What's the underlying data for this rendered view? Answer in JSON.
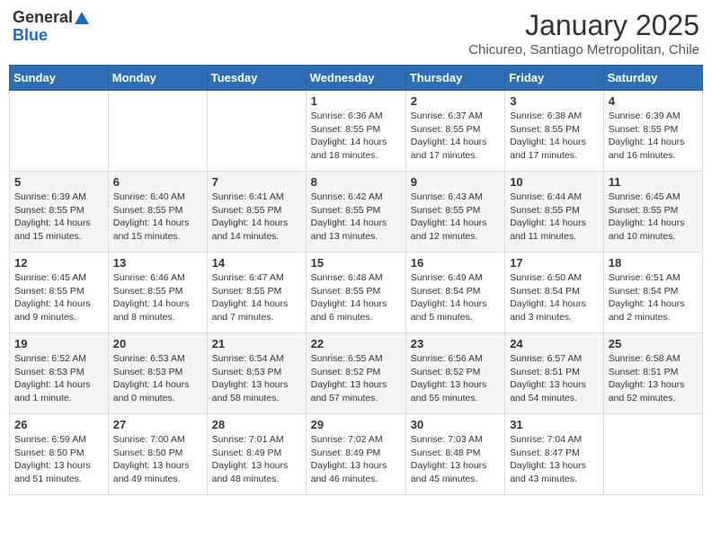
{
  "header": {
    "logo_general": "General",
    "logo_blue": "Blue",
    "month_title": "January 2025",
    "location": "Chicureo, Santiago Metropolitan, Chile"
  },
  "weekdays": [
    "Sunday",
    "Monday",
    "Tuesday",
    "Wednesday",
    "Thursday",
    "Friday",
    "Saturday"
  ],
  "weeks": [
    [
      {
        "day": "",
        "sunrise": "",
        "sunset": "",
        "daylight": ""
      },
      {
        "day": "",
        "sunrise": "",
        "sunset": "",
        "daylight": ""
      },
      {
        "day": "",
        "sunrise": "",
        "sunset": "",
        "daylight": ""
      },
      {
        "day": "1",
        "sunrise": "Sunrise: 6:36 AM",
        "sunset": "Sunset: 8:55 PM",
        "daylight": "Daylight: 14 hours and 18 minutes."
      },
      {
        "day": "2",
        "sunrise": "Sunrise: 6:37 AM",
        "sunset": "Sunset: 8:55 PM",
        "daylight": "Daylight: 14 hours and 17 minutes."
      },
      {
        "day": "3",
        "sunrise": "Sunrise: 6:38 AM",
        "sunset": "Sunset: 8:55 PM",
        "daylight": "Daylight: 14 hours and 17 minutes."
      },
      {
        "day": "4",
        "sunrise": "Sunrise: 6:39 AM",
        "sunset": "Sunset: 8:55 PM",
        "daylight": "Daylight: 14 hours and 16 minutes."
      }
    ],
    [
      {
        "day": "5",
        "sunrise": "Sunrise: 6:39 AM",
        "sunset": "Sunset: 8:55 PM",
        "daylight": "Daylight: 14 hours and 15 minutes."
      },
      {
        "day": "6",
        "sunrise": "Sunrise: 6:40 AM",
        "sunset": "Sunset: 8:55 PM",
        "daylight": "Daylight: 14 hours and 15 minutes."
      },
      {
        "day": "7",
        "sunrise": "Sunrise: 6:41 AM",
        "sunset": "Sunset: 8:55 PM",
        "daylight": "Daylight: 14 hours and 14 minutes."
      },
      {
        "day": "8",
        "sunrise": "Sunrise: 6:42 AM",
        "sunset": "Sunset: 8:55 PM",
        "daylight": "Daylight: 14 hours and 13 minutes."
      },
      {
        "day": "9",
        "sunrise": "Sunrise: 6:43 AM",
        "sunset": "Sunset: 8:55 PM",
        "daylight": "Daylight: 14 hours and 12 minutes."
      },
      {
        "day": "10",
        "sunrise": "Sunrise: 6:44 AM",
        "sunset": "Sunset: 8:55 PM",
        "daylight": "Daylight: 14 hours and 11 minutes."
      },
      {
        "day": "11",
        "sunrise": "Sunrise: 6:45 AM",
        "sunset": "Sunset: 8:55 PM",
        "daylight": "Daylight: 14 hours and 10 minutes."
      }
    ],
    [
      {
        "day": "12",
        "sunrise": "Sunrise: 6:45 AM",
        "sunset": "Sunset: 8:55 PM",
        "daylight": "Daylight: 14 hours and 9 minutes."
      },
      {
        "day": "13",
        "sunrise": "Sunrise: 6:46 AM",
        "sunset": "Sunset: 8:55 PM",
        "daylight": "Daylight: 14 hours and 8 minutes."
      },
      {
        "day": "14",
        "sunrise": "Sunrise: 6:47 AM",
        "sunset": "Sunset: 8:55 PM",
        "daylight": "Daylight: 14 hours and 7 minutes."
      },
      {
        "day": "15",
        "sunrise": "Sunrise: 6:48 AM",
        "sunset": "Sunset: 8:55 PM",
        "daylight": "Daylight: 14 hours and 6 minutes."
      },
      {
        "day": "16",
        "sunrise": "Sunrise: 6:49 AM",
        "sunset": "Sunset: 8:54 PM",
        "daylight": "Daylight: 14 hours and 5 minutes."
      },
      {
        "day": "17",
        "sunrise": "Sunrise: 6:50 AM",
        "sunset": "Sunset: 8:54 PM",
        "daylight": "Daylight: 14 hours and 3 minutes."
      },
      {
        "day": "18",
        "sunrise": "Sunrise: 6:51 AM",
        "sunset": "Sunset: 8:54 PM",
        "daylight": "Daylight: 14 hours and 2 minutes."
      }
    ],
    [
      {
        "day": "19",
        "sunrise": "Sunrise: 6:52 AM",
        "sunset": "Sunset: 8:53 PM",
        "daylight": "Daylight: 14 hours and 1 minute."
      },
      {
        "day": "20",
        "sunrise": "Sunrise: 6:53 AM",
        "sunset": "Sunset: 8:53 PM",
        "daylight": "Daylight: 14 hours and 0 minutes."
      },
      {
        "day": "21",
        "sunrise": "Sunrise: 6:54 AM",
        "sunset": "Sunset: 8:53 PM",
        "daylight": "Daylight: 13 hours and 58 minutes."
      },
      {
        "day": "22",
        "sunrise": "Sunrise: 6:55 AM",
        "sunset": "Sunset: 8:52 PM",
        "daylight": "Daylight: 13 hours and 57 minutes."
      },
      {
        "day": "23",
        "sunrise": "Sunrise: 6:56 AM",
        "sunset": "Sunset: 8:52 PM",
        "daylight": "Daylight: 13 hours and 55 minutes."
      },
      {
        "day": "24",
        "sunrise": "Sunrise: 6:57 AM",
        "sunset": "Sunset: 8:51 PM",
        "daylight": "Daylight: 13 hours and 54 minutes."
      },
      {
        "day": "25",
        "sunrise": "Sunrise: 6:58 AM",
        "sunset": "Sunset: 8:51 PM",
        "daylight": "Daylight: 13 hours and 52 minutes."
      }
    ],
    [
      {
        "day": "26",
        "sunrise": "Sunrise: 6:59 AM",
        "sunset": "Sunset: 8:50 PM",
        "daylight": "Daylight: 13 hours and 51 minutes."
      },
      {
        "day": "27",
        "sunrise": "Sunrise: 7:00 AM",
        "sunset": "Sunset: 8:50 PM",
        "daylight": "Daylight: 13 hours and 49 minutes."
      },
      {
        "day": "28",
        "sunrise": "Sunrise: 7:01 AM",
        "sunset": "Sunset: 8:49 PM",
        "daylight": "Daylight: 13 hours and 48 minutes."
      },
      {
        "day": "29",
        "sunrise": "Sunrise: 7:02 AM",
        "sunset": "Sunset: 8:49 PM",
        "daylight": "Daylight: 13 hours and 46 minutes."
      },
      {
        "day": "30",
        "sunrise": "Sunrise: 7:03 AM",
        "sunset": "Sunset: 8:48 PM",
        "daylight": "Daylight: 13 hours and 45 minutes."
      },
      {
        "day": "31",
        "sunrise": "Sunrise: 7:04 AM",
        "sunset": "Sunset: 8:47 PM",
        "daylight": "Daylight: 13 hours and 43 minutes."
      },
      {
        "day": "",
        "sunrise": "",
        "sunset": "",
        "daylight": ""
      }
    ]
  ]
}
